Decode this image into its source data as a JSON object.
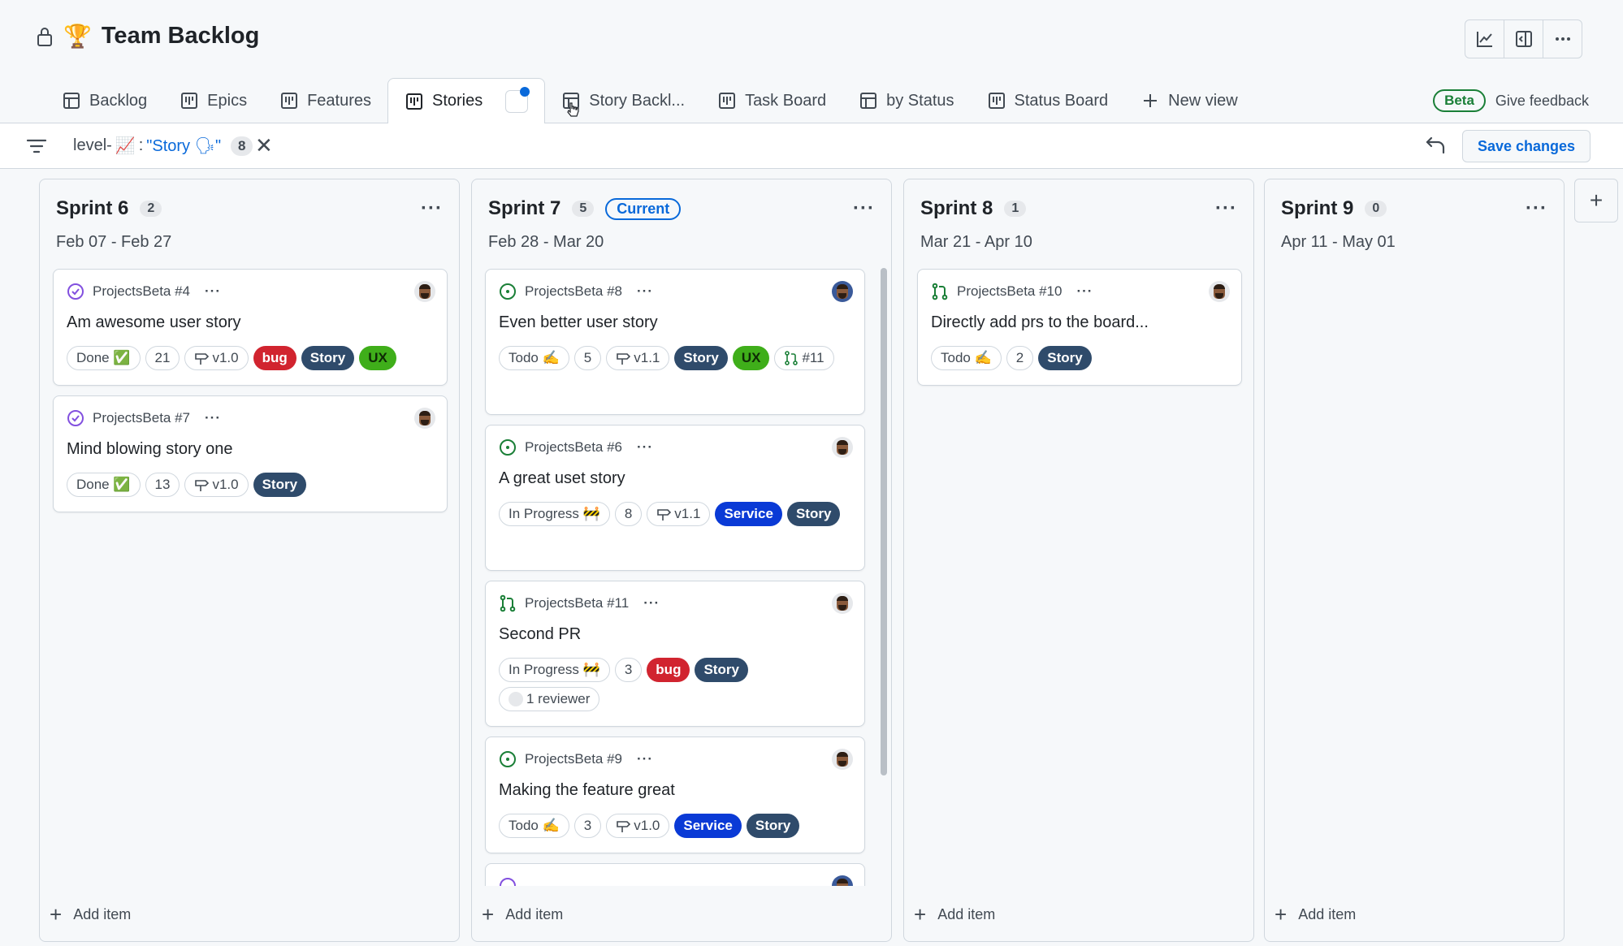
{
  "project": {
    "title": "Team Backlog",
    "trophy": "🏆"
  },
  "tabs": [
    {
      "label": "Backlog",
      "icon": "table-icon"
    },
    {
      "label": "Epics",
      "icon": "board-icon"
    },
    {
      "label": "Features",
      "icon": "board-icon"
    },
    {
      "label": "Stories",
      "icon": "board-icon",
      "active": true
    },
    {
      "label": "Story Backl...",
      "icon": "table-icon"
    },
    {
      "label": "Task Board",
      "icon": "board-icon"
    },
    {
      "label": "by Status",
      "icon": "table-icon"
    },
    {
      "label": "Status Board",
      "icon": "board-icon"
    },
    {
      "label": "New view",
      "icon": "plus-icon"
    }
  ],
  "beta": {
    "badge": "Beta",
    "feedback": "Give feedback"
  },
  "filter": {
    "prefix": "level-",
    "emoji": "📈",
    "colon": ":",
    "query": "\"Story 🗣\"",
    "count": "8",
    "clear": "✕"
  },
  "save_label": "Save changes",
  "columns": [
    {
      "name": "Sprint 6",
      "count": "2",
      "dates": "Feb 07 - Feb 27",
      "current": "",
      "cards": [
        {
          "status": "done",
          "ref": "ProjectsBeta #4",
          "title": "Am awesome user story",
          "tokens": [
            "Done ✅",
            "21",
            "v1.0"
          ],
          "labels": [
            "bug",
            "Story",
            "UX"
          ]
        },
        {
          "status": "done",
          "ref": "ProjectsBeta #7",
          "title": "Mind blowing story one",
          "tokens": [
            "Done ✅",
            "13",
            "v1.0"
          ],
          "labels": [
            "Story"
          ]
        }
      ]
    },
    {
      "name": "Sprint 7",
      "count": "5",
      "dates": "Feb 28 - Mar 20",
      "current": "Current",
      "cards": [
        {
          "status": "open",
          "ref": "ProjectsBeta #8",
          "title": "Even better user story",
          "tokens": [
            "Todo ✍️",
            "5",
            "v1.1"
          ],
          "labels": [
            "Story",
            "UX"
          ],
          "pr": "#11"
        },
        {
          "status": "open",
          "ref": "ProjectsBeta #6",
          "title": "A great uset story",
          "tokens": [
            "In Progress 🚧",
            "8",
            "v1.1"
          ],
          "labels": [
            "Service",
            "Story"
          ]
        },
        {
          "status": "pr",
          "ref": "ProjectsBeta #11",
          "title": "Second PR",
          "tokens": [
            "In Progress 🚧",
            "3"
          ],
          "labels": [
            "bug",
            "Story"
          ],
          "reviewer": "1 reviewer"
        },
        {
          "status": "open",
          "ref": "ProjectsBeta #9",
          "title": "Making the feature great",
          "tokens": [
            "Todo ✍️",
            "3",
            "v1.0"
          ],
          "labels": [
            "Service",
            "Story"
          ]
        }
      ]
    },
    {
      "name": "Sprint 8",
      "count": "1",
      "dates": "Mar 21 - Apr 10",
      "current": "",
      "cards": [
        {
          "status": "pr",
          "ref": "ProjectsBeta #10",
          "title": "Directly add prs to the board...",
          "tokens": [
            "Todo ✍️",
            "2"
          ],
          "labels": [
            "Story"
          ]
        }
      ]
    },
    {
      "name": "Sprint 9",
      "count": "0",
      "dates": "Apr 11 - May 01",
      "current": "",
      "cards": []
    }
  ],
  "add_item_label": "Add item",
  "more": "···",
  "colors": {
    "accent": "#0969da",
    "done": "#8250df",
    "open": "#1a7f37",
    "bug": "#d1242f",
    "story": "#2f4b6b",
    "ux": "#3fae1a",
    "service": "#0a3ad6"
  }
}
